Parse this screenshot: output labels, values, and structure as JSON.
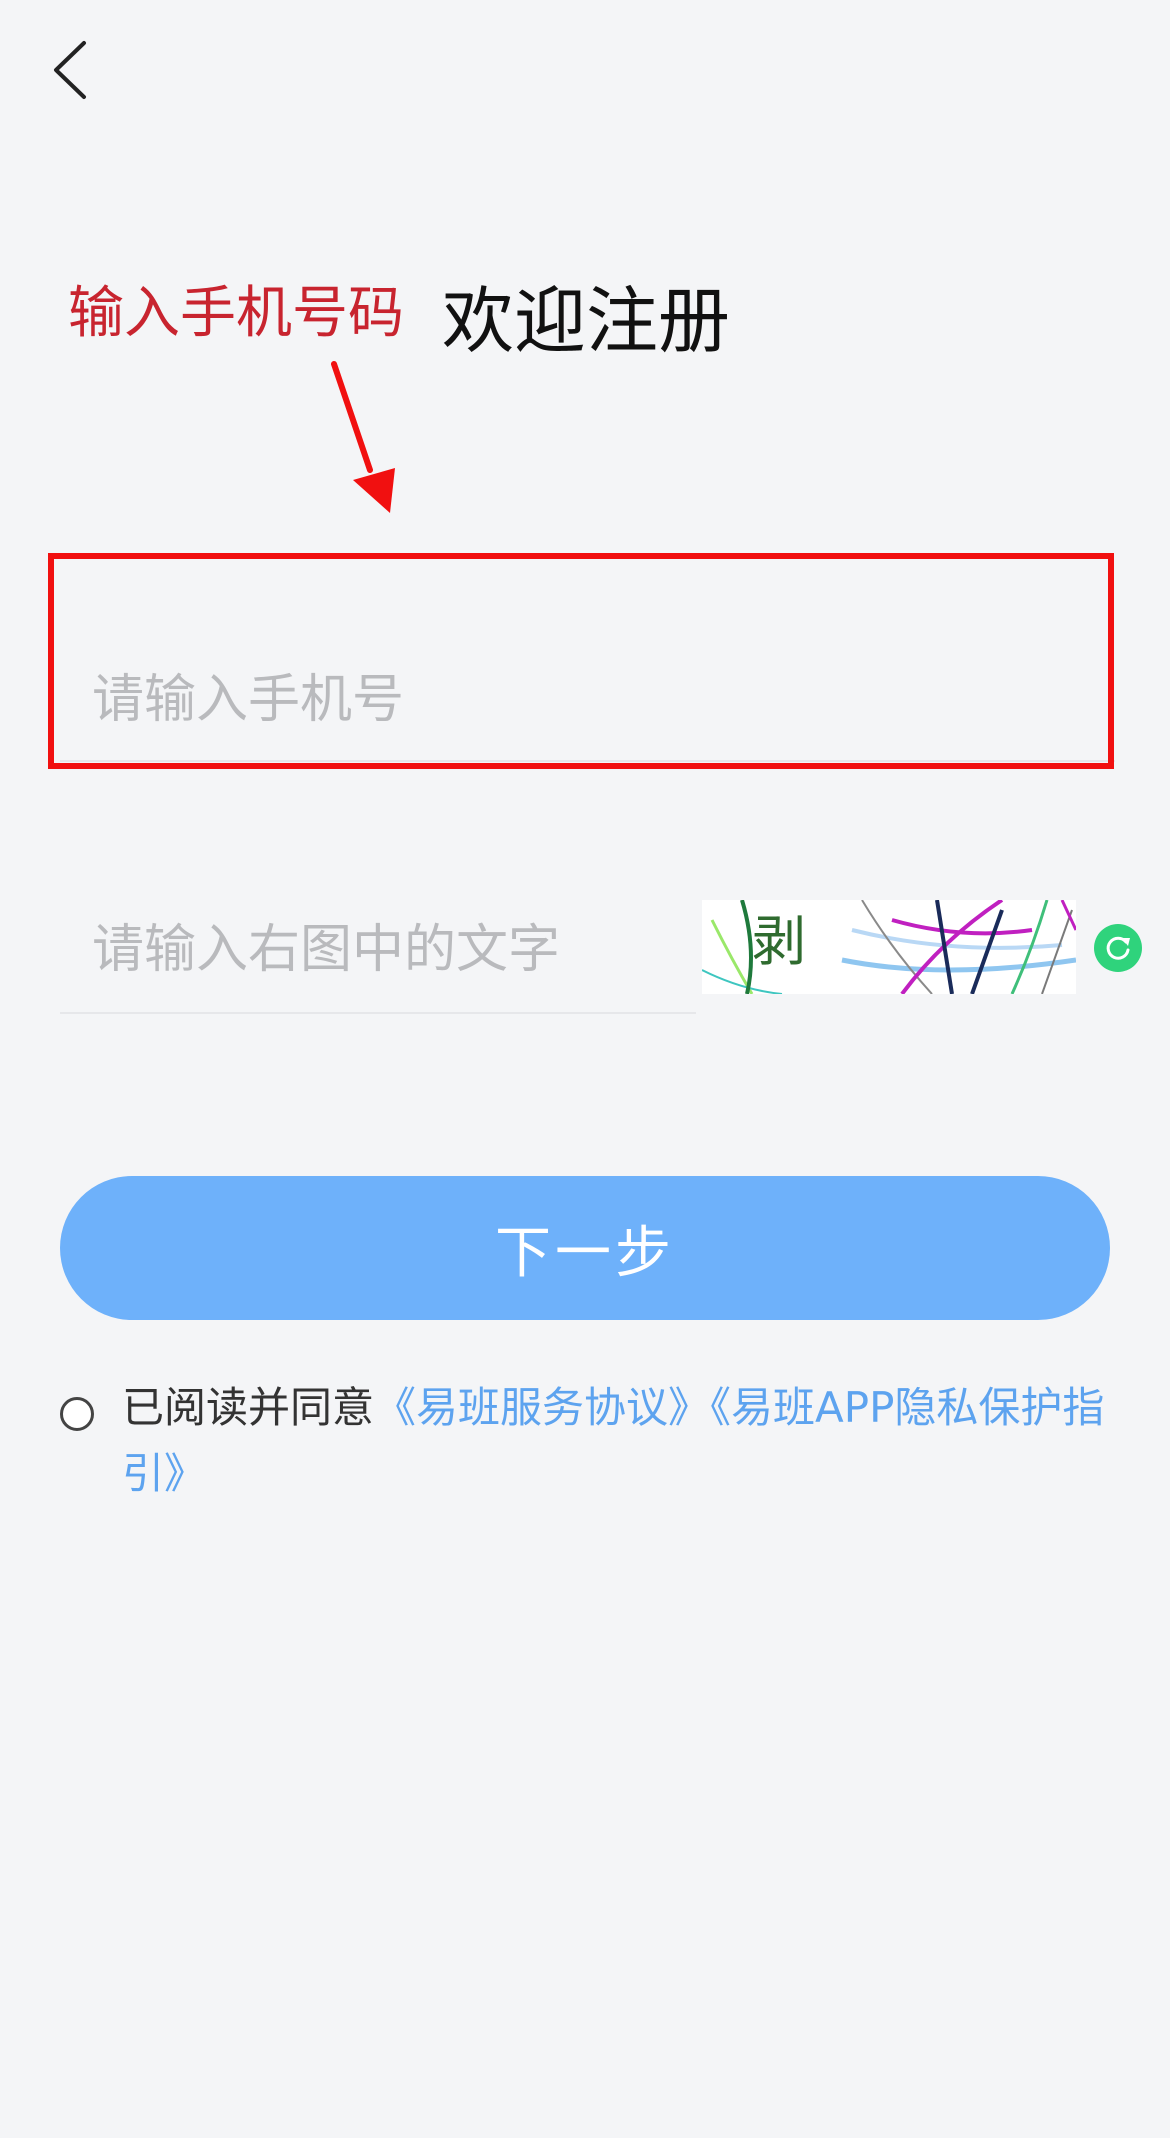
{
  "header": {
    "back_icon": "chevron-left-icon"
  },
  "annotation": {
    "label": "输入手机号码",
    "color": "#c8242f"
  },
  "title": "欢迎注册",
  "phone": {
    "placeholder": "请输入手机号",
    "value": ""
  },
  "captcha": {
    "placeholder": "请输入右图中的文字",
    "value": "",
    "image_text": "剥",
    "refresh_icon": "refresh-icon"
  },
  "next_button": {
    "label": "下一步",
    "color": "#6eb1fa"
  },
  "agreement": {
    "prefix": "已阅读并同意",
    "service_link": "《易班服务协议》",
    "privacy_link": "《易班APP隐私保护指引》",
    "link_color": "#5da3ef",
    "checked": false
  }
}
